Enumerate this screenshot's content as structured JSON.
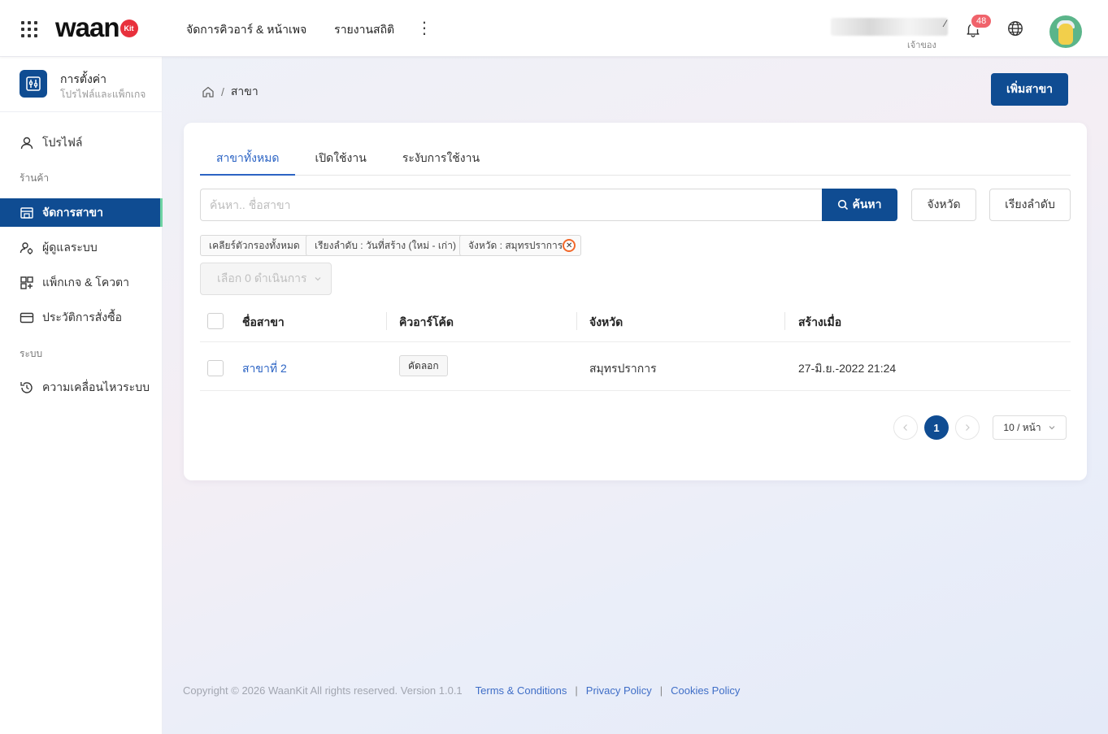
{
  "topbar": {
    "logo_text": "waan",
    "logo_badge": "Kit",
    "nav": [
      "จัดการคิวอาร์ & หน้าเพจ",
      "รายงานสถิติ"
    ],
    "more_icon": "more-vertical-icon",
    "user_role": "เจ้าของ",
    "notification_count": "48"
  },
  "sidebar": {
    "header_title": "การตั้งค่า",
    "header_subtitle": "โปรไฟล์และแพ็กเกจ",
    "profile": "โปรไฟล์",
    "section_store": "ร้านค้า",
    "items_store": [
      "จัดการสาขา",
      "ผู้ดูแลระบบ",
      "แพ็กเกจ & โควตา",
      "ประวัติการสั่งซื้อ"
    ],
    "section_system": "ระบบ",
    "items_system": [
      "ความเคลื่อนไหวระบบ"
    ],
    "active_item": "จัดการสาขา",
    "accent_color": "#0f4c92",
    "active_indicator_color": "#6fd3a3"
  },
  "page": {
    "breadcrumb_current": "สาขา",
    "add_button": "เพิ่มสาขา",
    "tabs": [
      "สาขาทั้งหมด",
      "เปิดใช้งาน",
      "ระงับการใช้งาน"
    ],
    "active_tab": "สาขาทั้งหมด",
    "search": {
      "placeholder": "ค้นหา.. ชื่อสาขา",
      "value": "",
      "button": "ค้นหา"
    },
    "filter_province": "จังหวัด",
    "filter_sort": "เรียงลำดับ",
    "chips": {
      "clear": "เคลียร์ตัวกรองทั้งหมด",
      "sort": "เรียงลำดับ : วันที่สร้าง (ใหม่ - เก่า)",
      "province": "จังหวัด : สมุทรปราการ"
    },
    "bulk_action": "เลือก 0 ดำเนินการ",
    "table": {
      "headers": [
        "ชื่อสาขา",
        "คิวอาร์โค้ด",
        "จังหวัด",
        "สร้างเมื่อ"
      ],
      "rows": [
        {
          "name": "สาขาที่ 2",
          "qr_action": "คัดลอก",
          "province": "สมุทรปราการ",
          "created": "27-มิ.ย.-2022 21:24"
        }
      ]
    },
    "pagination": {
      "current": "1",
      "page_size": "10 / หน้า"
    }
  },
  "footer": {
    "copyright": "Copyright © 2026 WaanKit All rights reserved. Version 1.0.1",
    "links": [
      "Terms & Conditions",
      "Privacy Policy",
      "Cookies Policy"
    ],
    "separator": "|"
  }
}
